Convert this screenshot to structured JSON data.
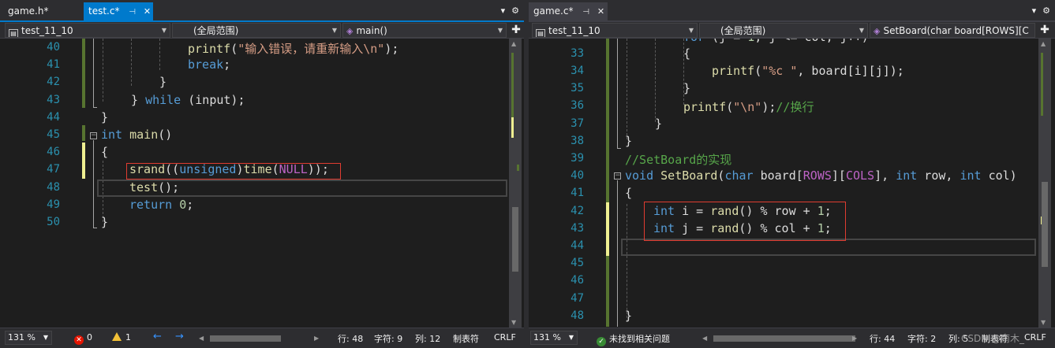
{
  "left": {
    "tabs": [
      {
        "label": "game.h*"
      },
      {
        "label": "test.c*",
        "pin": "⊣",
        "close": "✕"
      }
    ],
    "nav": {
      "project": "test_11_10",
      "scope": "(全局范围)",
      "member": "main()"
    },
    "lines": {
      "n40": "40",
      "n41": "41",
      "n42": "42",
      "n43": "43",
      "n44": "44",
      "n45": "45",
      "n46": "46",
      "n47": "47",
      "n48": "48",
      "n49": "49",
      "n50": "50"
    },
    "status": {
      "zoom": "131 %",
      "errors": "0",
      "warnings": "1",
      "row": "行: 48",
      "col_char": "字符: 9",
      "col": "列: 12",
      "tabs": "制表符",
      "eol": "CRLF"
    }
  },
  "right": {
    "tabs": [
      {
        "label": "game.c*",
        "pin": "⊣",
        "close": "✕"
      }
    ],
    "nav": {
      "project": "test_11_10",
      "scope": "(全局范围)",
      "member": "SetBoard(char board[ROWS][C"
    },
    "lines": {
      "n33": "33",
      "n34": "34",
      "n35": "35",
      "n36": "36",
      "n37": "37",
      "n38": "38",
      "n39": "39",
      "n40": "40",
      "n41": "41",
      "n42": "42",
      "n43": "43",
      "n44": "44",
      "n45": "45",
      "n46": "46",
      "n47": "47",
      "n48": "48"
    },
    "status": {
      "zoom": "131 %",
      "issues": "未找到相关问题",
      "row": "行: 44",
      "col_char": "字符: 2",
      "col": "列: 5",
      "tabs": "制表符",
      "eol": "CRLF"
    },
    "watermark": "CSDN @南木_"
  },
  "colors": {
    "accent": "#007acc",
    "keyword": "#569cd6",
    "string": "#d69d85",
    "comment": "#57a64a",
    "highlight_box": "#e03c31"
  }
}
